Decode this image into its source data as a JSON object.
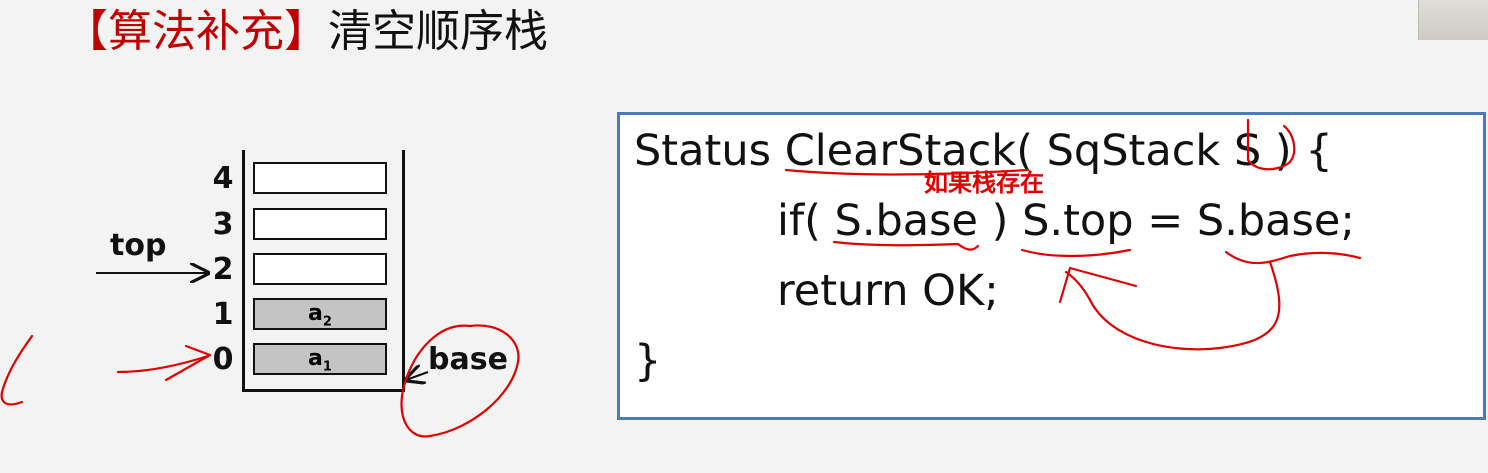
{
  "title": {
    "tag": "【算法补充】",
    "text": "清空顺序栈"
  },
  "stack": {
    "cells": [
      {
        "index": "4",
        "content": "",
        "filled": false
      },
      {
        "index": "3",
        "content": "",
        "filled": false
      },
      {
        "index": "2",
        "content": "",
        "filled": false
      },
      {
        "index": "1",
        "content": "a",
        "sub": "2",
        "filled": true
      },
      {
        "index": "0",
        "content": "a",
        "sub": "1",
        "filled": true
      }
    ],
    "top_label": "top",
    "base_label": "base"
  },
  "code": {
    "lines": [
      "Status ClearStack( SqStack S ) {",
      "if( S.base ) S.top = S.base;",
      "return OK;",
      "}"
    ]
  },
  "annotation": "如果栈存在",
  "colors": {
    "accent": "#c00000",
    "ink": "#e00000",
    "box_border": "#4a7ab8",
    "cell_fill": "#c4c4c4"
  }
}
